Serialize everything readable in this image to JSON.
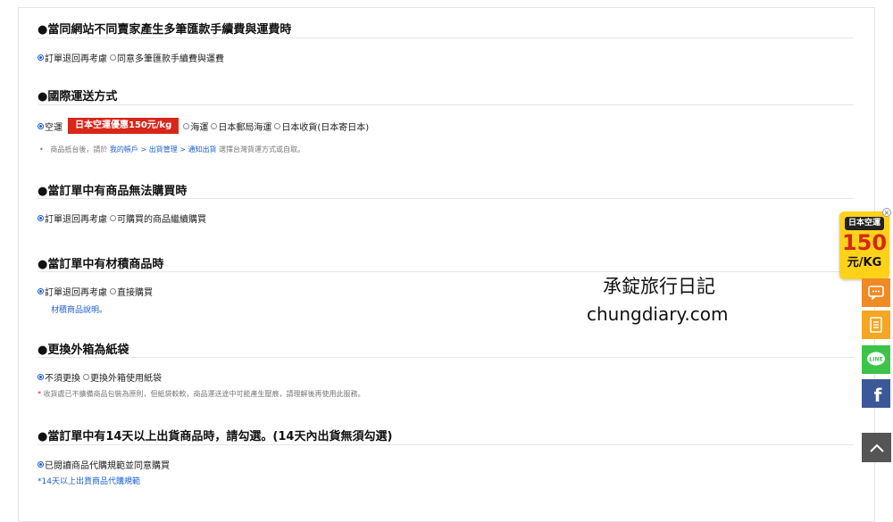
{
  "sections": [
    {
      "title": "●當同網站不同賣家產生多筆匯款手續費與運費時",
      "options": [
        {
          "label": "訂單退回再考慮",
          "selected": true
        },
        {
          "label": "同意多筆匯款手續費與運費",
          "selected": false
        }
      ]
    },
    {
      "title": "●國際運送方式",
      "options": [
        {
          "label": "空運",
          "selected": true
        },
        {
          "label": "海運",
          "selected": false
        },
        {
          "label": "日本郵局海運",
          "selected": false
        },
        {
          "label": "日本收貨(日本寄日本)",
          "selected": false
        }
      ],
      "promo_badge": "日本空運優惠150元/kg",
      "note": {
        "bullet": "•",
        "prefix": "商品抵台後，請於",
        "link": "我的帳戶 > 出貨管理 > 通知出貨",
        "suffix": "選擇台灣貨運方式或自取。"
      }
    },
    {
      "title": "●當訂單中有商品無法購買時",
      "options": [
        {
          "label": "訂單退回再考慮",
          "selected": true
        },
        {
          "label": "可購買的商品繼續購買",
          "selected": false
        }
      ]
    },
    {
      "title": "●當訂單中有材積商品時",
      "options": [
        {
          "label": "訂單退回再考慮",
          "selected": true
        },
        {
          "label": "直接購買",
          "selected": false
        }
      ],
      "link": "材積商品說明。"
    },
    {
      "title": "●更換外箱為紙袋",
      "options": [
        {
          "label": "不須更換",
          "selected": true
        },
        {
          "label": "更換外箱使用紙袋",
          "selected": false
        }
      ],
      "note": {
        "star": "*",
        "text": "收貨處已不擴備商品包裝為原則，但紙袋較軟，商品運送途中可能產生壓痕，請理解後再使用此服務。"
      }
    },
    {
      "title": "●當訂單中有14天以上出貨商品時，請勾選。(14天內出貨無須勾選)",
      "options": [
        {
          "label": "已閱讀商品代購規範並同意購買",
          "selected": true
        }
      ],
      "link": "*14天以上出貨商品代購規範"
    }
  ],
  "watermark": {
    "line1": "承錠旅行日記",
    "line2": "chungdiary.com"
  },
  "sidebar": {
    "promo": {
      "tag": "日本空運",
      "amount": "150",
      "unit": "元/KG",
      "close": "×"
    },
    "buttons": [
      {
        "icon": "chat-icon",
        "color": "#f08a24"
      },
      {
        "icon": "book-icon",
        "color": "#f5a623"
      },
      {
        "icon": "line-icon",
        "color": "#3cc34a",
        "text": "LINE"
      },
      {
        "icon": "facebook-icon",
        "color": "#3b5998",
        "text": "f"
      }
    ],
    "back_to_top": "scroll-top-icon"
  },
  "colors": {
    "accent_red": "#d8261a",
    "link_blue": "#1a5fd0"
  }
}
